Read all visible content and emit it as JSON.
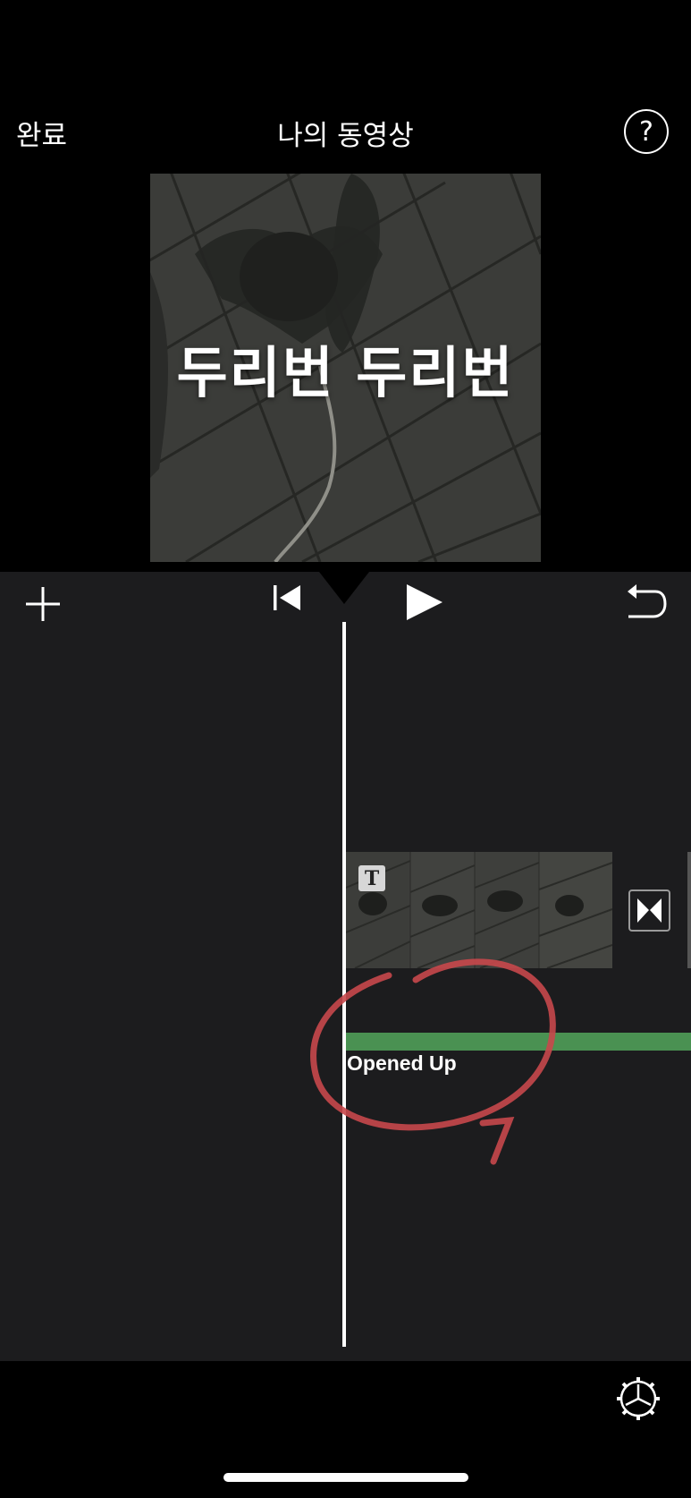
{
  "header": {
    "done_label": "완료",
    "project_title": "나의 동영상",
    "help_label": "?"
  },
  "viewer": {
    "overlay_title": "두리번 두리번"
  },
  "transport": {
    "add_icon": "plus-icon",
    "skip_back_icon": "skip-to-start-icon",
    "play_icon": "play-icon",
    "undo_icon": "undo-icon"
  },
  "timeline": {
    "title_badge": "T",
    "transition_icon": "transition-icon",
    "audio_track_label": "Opened Up",
    "audio_color": "#4a9152"
  },
  "footer": {
    "settings_icon": "gear-icon"
  },
  "colors": {
    "background": "#000000",
    "timeline_background": "#1c1c1e",
    "annotation": "#c8484b"
  }
}
